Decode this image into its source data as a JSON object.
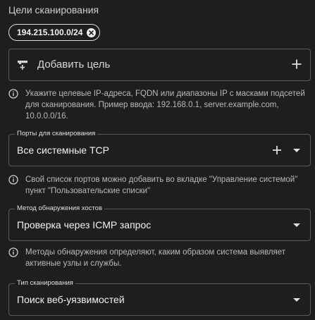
{
  "targets": {
    "title": "Цели сканирования",
    "chips": [
      "194.215.100.0/24"
    ],
    "add_label": "Добавить цель",
    "hint": "Укажите целевые IP-адреса, FQDN или диапазоны IP с масками подсетей для сканирования. Пример ввода: 192.168.0.1, server.example.com, 10.0.0.0/16."
  },
  "ports": {
    "label": "Порты для сканирования",
    "value": "Все системные TCP",
    "hint": "Свой список портов можно добавить во вкладке \"Управление системой\" пункт \"Пользовательские списки\""
  },
  "host_discovery": {
    "label": "Метод обнаружения хостов",
    "value": "Проверка через ICMP запрос",
    "hint": "Методы обнаружения определяют, каким образом система выявляет активные узлы и службы."
  },
  "scan_type": {
    "label": "Тип сканирования",
    "value": "Поиск веб-уязвимостей"
  },
  "colors": {
    "background": "#1e1e1e",
    "border": "#5a5a5a",
    "text": "#f2f2f2",
    "hint_text": "#b9b9b9"
  },
  "icons": [
    "close-icon",
    "add-target-icon",
    "plus-icon",
    "info-icon",
    "chevron-down-icon"
  ]
}
